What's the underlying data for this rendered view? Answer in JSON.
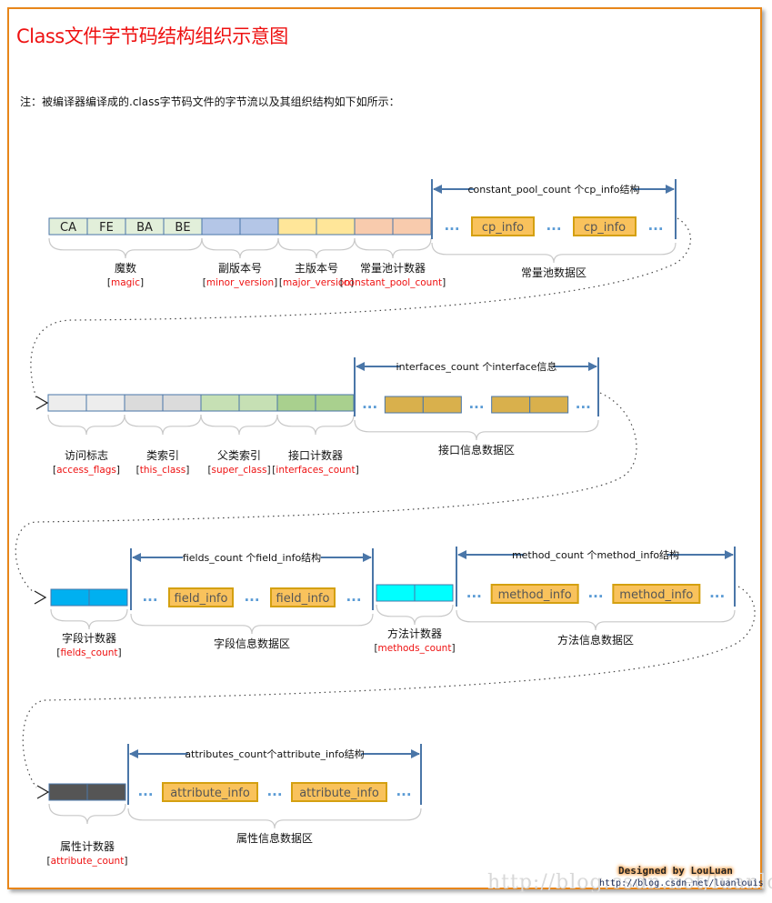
{
  "title": "Class文件字节码结构组织示意图",
  "note": "注：被编译器编译成的.class字节码文件的字节流以及其组织结构如下如所示：",
  "colors": {
    "frame_border": "#e8861a",
    "title": "#ee1111",
    "cell_border": "#4a76a8",
    "arrow": "#4a76a8",
    "magic": "#e2efda",
    "minor_version": "#b4c6e7",
    "major_version": "#ffe699",
    "constant_pool_count": "#f8cbad",
    "access_flags": "#ededed",
    "this_class": "#dbdbdb",
    "super_class": "#c6e0b4",
    "interfaces_count": "#a9d08e",
    "interface_item": "#d9b04c",
    "fields_count": "#00b0f0",
    "methods_count": "#00ffff",
    "attribute_count": "#555555",
    "info_box_fill": "#f9c25c",
    "info_box_border": "#d4a010"
  },
  "rows": [
    {
      "fields": [
        {
          "id": "magic",
          "cn": "魔数",
          "en": "magic",
          "cells": [
            "CA",
            "FE",
            "BA",
            "BE"
          ]
        },
        {
          "id": "minor_version",
          "cn": "副版本号",
          "en": "minor_version",
          "cells": [
            "",
            ""
          ]
        },
        {
          "id": "major_version",
          "cn": "主版本号",
          "en": "major_version",
          "cells": [
            "",
            ""
          ]
        },
        {
          "id": "constant_pool_count",
          "cn": "常量池计数器",
          "en": "constant_pool_count",
          "cells": [
            "",
            ""
          ]
        }
      ],
      "area": {
        "span_label": "constant_pool_count 个cp_info结构",
        "items": [
          "cp_info",
          "cp_info"
        ],
        "label": "常量池数据区"
      }
    },
    {
      "fields": [
        {
          "id": "access_flags",
          "cn": "访问标志",
          "en": "access_flags",
          "cells": [
            "",
            ""
          ]
        },
        {
          "id": "this_class",
          "cn": "类索引",
          "en": "this_class",
          "cells": [
            "",
            ""
          ]
        },
        {
          "id": "super_class",
          "cn": "父类索引",
          "en": "super_class",
          "cells": [
            "",
            ""
          ]
        },
        {
          "id": "interfaces_count",
          "cn": "接口计数器",
          "en": "interfaces_count",
          "cells": [
            "",
            ""
          ]
        }
      ],
      "area": {
        "span_label": "interfaces_count 个interface信息",
        "items": [
          "",
          ""
        ],
        "label": "接口信息数据区"
      }
    },
    {
      "fields": [
        {
          "id": "fields_count",
          "cn": "字段计数器",
          "en": "fields_count",
          "cells": [
            "",
            ""
          ]
        }
      ],
      "area": {
        "span_label": "fields_count 个field_info结构",
        "items": [
          "field_info",
          "field_info"
        ],
        "label": "字段信息数据区"
      },
      "fields2": [
        {
          "id": "methods_count",
          "cn": "方法计数器",
          "en": "methods_count",
          "cells": [
            "",
            ""
          ]
        }
      ],
      "area2": {
        "span_label": "method_count 个method_info结构",
        "items": [
          "method_info",
          "method_info"
        ],
        "label": "方法信息数据区"
      }
    },
    {
      "fields": [
        {
          "id": "attribute_count",
          "cn": "属性计数器",
          "en": "attribute_count",
          "cells": [
            "",
            ""
          ]
        }
      ],
      "area": {
        "span_label": "attributes_count个attribute_info结构",
        "items": [
          "attribute_info",
          "attribute_info"
        ],
        "label": "属性信息数据区"
      }
    }
  ],
  "ellipsis": "...",
  "watermark": "http://blog.csdn.net/luanlouis",
  "designed_by": "Designed by LouLuan",
  "url": "http://blog.csdn.net/luanlouis"
}
